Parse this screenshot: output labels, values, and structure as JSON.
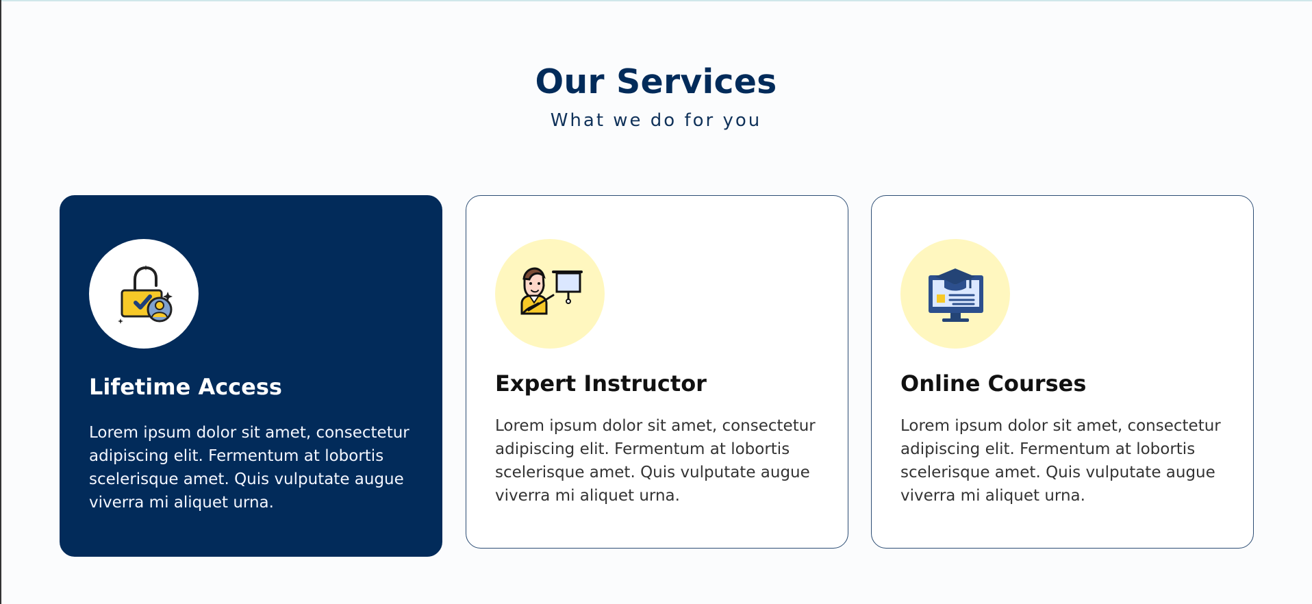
{
  "section": {
    "title": "Our Services",
    "subtitle": "What we do for you"
  },
  "cards": [
    {
      "title": "Lifetime Access",
      "description": "Lorem ipsum dolor sit amet, consectetur adipiscing elit. Fermentum at lobortis scelerisque amet. Quis vulputate augue viverra mi aliquet urna.",
      "icon": "unlocked-padlock-user-icon",
      "active": true
    },
    {
      "title": "Expert Instructor",
      "description": "Lorem ipsum dolor sit amet, consectetur adipiscing elit. Fermentum at lobortis scelerisque amet. Quis vulputate augue viverra mi aliquet urna.",
      "icon": "instructor-presentation-icon",
      "active": false
    },
    {
      "title": "Online Courses",
      "description": "Lorem ipsum dolor sit amet, consectetur adipiscing elit. Fermentum at lobortis scelerisque amet. Quis vulputate augue viverra mi aliquet urna.",
      "icon": "online-course-monitor-icon",
      "active": false
    }
  ],
  "colors": {
    "primary": "#022b5a",
    "icon_background": "#fff7bf",
    "active_card": "#022b5a",
    "card_border": "#2b4c73",
    "accent_yellow": "#f7c928",
    "icon_blue": "#2c4f8d"
  }
}
